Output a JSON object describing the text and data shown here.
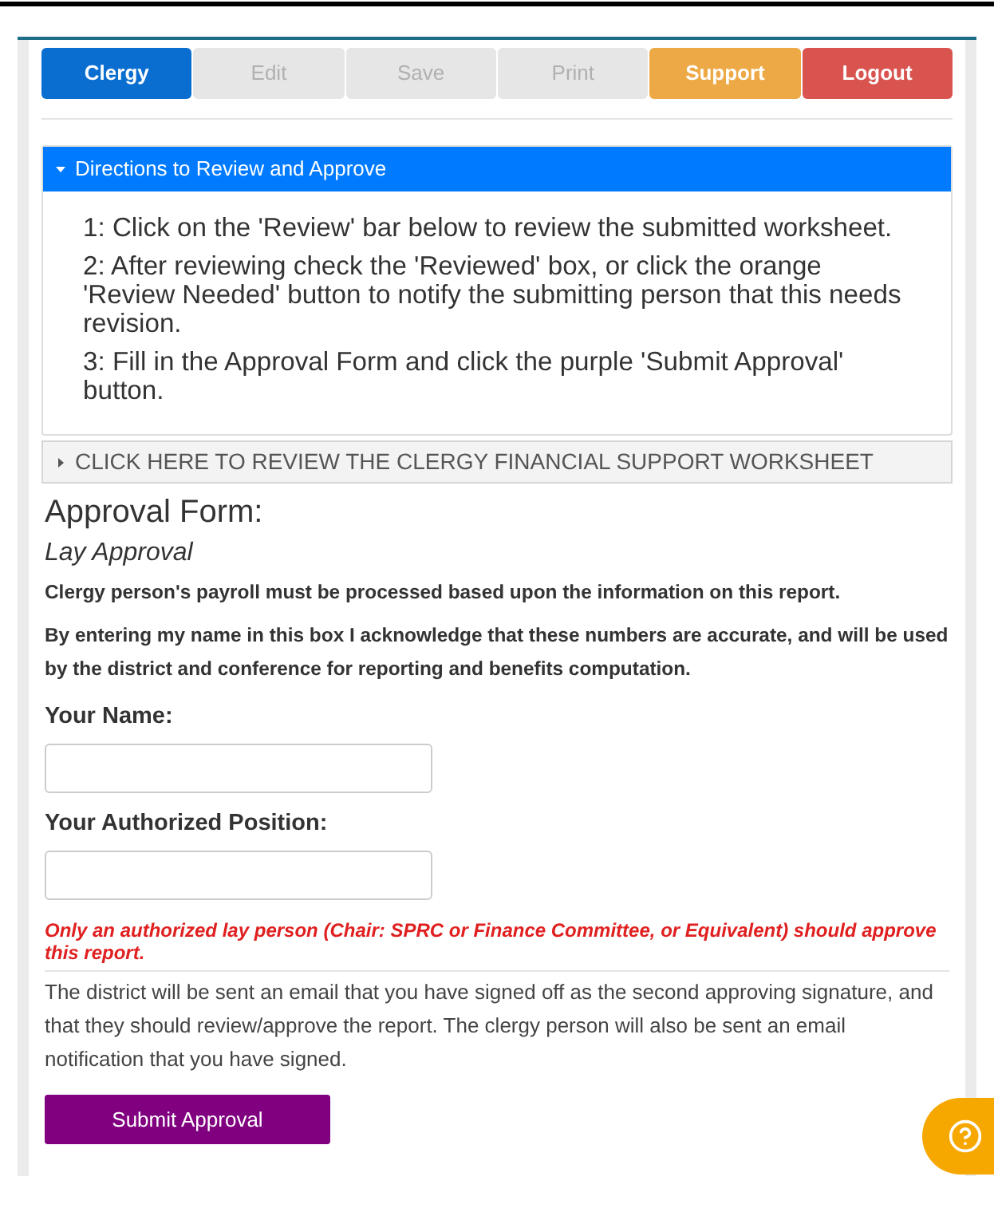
{
  "nav_buttons": [
    {
      "label": "Clergy",
      "kind": "primary",
      "disabled": false
    },
    {
      "label": "Edit",
      "kind": "default",
      "disabled": true
    },
    {
      "label": "Save",
      "kind": "default",
      "disabled": true
    },
    {
      "label": "Print",
      "kind": "default",
      "disabled": true
    },
    {
      "label": "Support",
      "kind": "warning",
      "disabled": false
    },
    {
      "label": "Logout",
      "kind": "danger",
      "disabled": false
    }
  ],
  "directions": {
    "title": "Directions to Review and Approve",
    "expanded": true,
    "steps": [
      "1: Click on the 'Review' bar below to review the submitted worksheet.",
      "2: After reviewing check the 'Reviewed' box, or click the orange 'Review Needed' button to notify the submitting person that this needs revision.",
      "3: Fill in the Approval Form and click the purple 'Submit Approval' button."
    ]
  },
  "worksheet_bar": {
    "title": "CLICK HERE TO REVIEW THE CLERGY FINANCIAL SUPPORT WORKSHEET",
    "expanded": false
  },
  "form": {
    "heading": "Approval Form:",
    "subheading": "Lay Approval",
    "notes": [
      "Clergy person's payroll must be processed based upon the information on this report.",
      "By entering my name in this box I acknowledge that these numbers are accurate, and will be used by the district and conference for reporting and benefits computation."
    ],
    "fields": [
      {
        "label": "Your Name:"
      },
      {
        "label": "Your Authorized Position:"
      }
    ],
    "warning": "Only an authorized lay person (Chair: SPRC or Finance Committee, or Equivalent) should approve this report.",
    "info": "The district will be sent an email that you have signed off as the second approving signature, and that they should review/approve the report. The clergy person will also be sent an email notification that you have signed.",
    "submit": "Submit Approval"
  }
}
